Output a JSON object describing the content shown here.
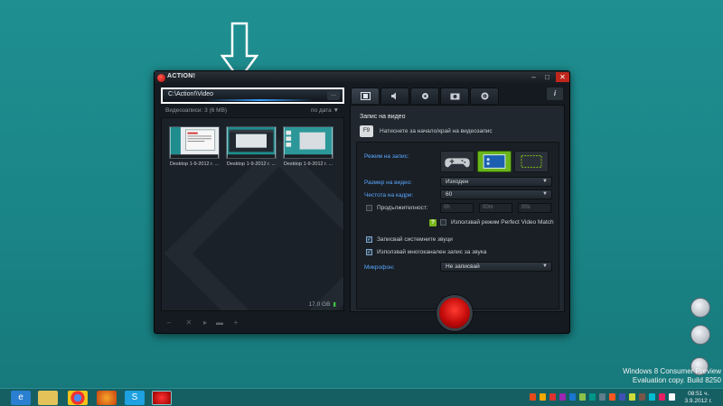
{
  "app": {
    "title": "ACTION!",
    "window_controls": {
      "minimize": "–",
      "maximize": "□",
      "close": "✕"
    }
  },
  "left_pane": {
    "path": "C:\\Action!\\Video",
    "path_browse": "...",
    "files_count": "Видеозаписи: 3 (6 MB)",
    "sort_label": "по дата",
    "sort_caret": "▼",
    "thumbnails": [
      {
        "label": "Desktop 1-9-2012 г. ..."
      },
      {
        "label": "Desktop 1-9-2012 г. ..."
      },
      {
        "label": "Desktop 1-9-2012 г. ..."
      }
    ],
    "disk_free": "17.0 GB",
    "disk_indicator": "▮",
    "toolbar": {
      "remove": "–",
      "delete": "✕",
      "play": "▸",
      "folder": "▬",
      "add": "+"
    }
  },
  "right_pane": {
    "info": "i",
    "section_title": "Запис на видео",
    "hotkey_key": "F9",
    "hotkey_text": "Натиснете за начало/край на видеозапис",
    "recording_mode_label": "Режим на запис:",
    "video_size_label": "Размер на видео:",
    "video_size_value": "Изходен",
    "fps_label": "Честота на кадри:",
    "fps_value": "60",
    "duration_label": "Продължителност:",
    "duration_h": "0h",
    "duration_m": "00m",
    "duration_s": "00s",
    "perfect_match_help": "?",
    "perfect_match_label": "Използвай режим Perfect Video Match",
    "system_sounds_label": "Записвай системните звуци",
    "multichannel_label": "Използвай многоканален запис за звука",
    "microphone_label": "Микрофон:",
    "microphone_value": "Не записвай",
    "caret": "▼",
    "checkmark": "✓"
  },
  "desktop": {
    "watermark_line1": "Windows 8 Consumer Preview",
    "watermark_line2": "Evaluation copy. Build 8250",
    "clock_time": "08:51 ч.",
    "clock_date": "3.9.2012 г."
  },
  "colors": {
    "desktop": "#1e8a8c",
    "window": "#151a20",
    "accent_blue": "#5aa7ff",
    "record_red": "#e0140f",
    "mode_selected": "#6ab51d"
  }
}
